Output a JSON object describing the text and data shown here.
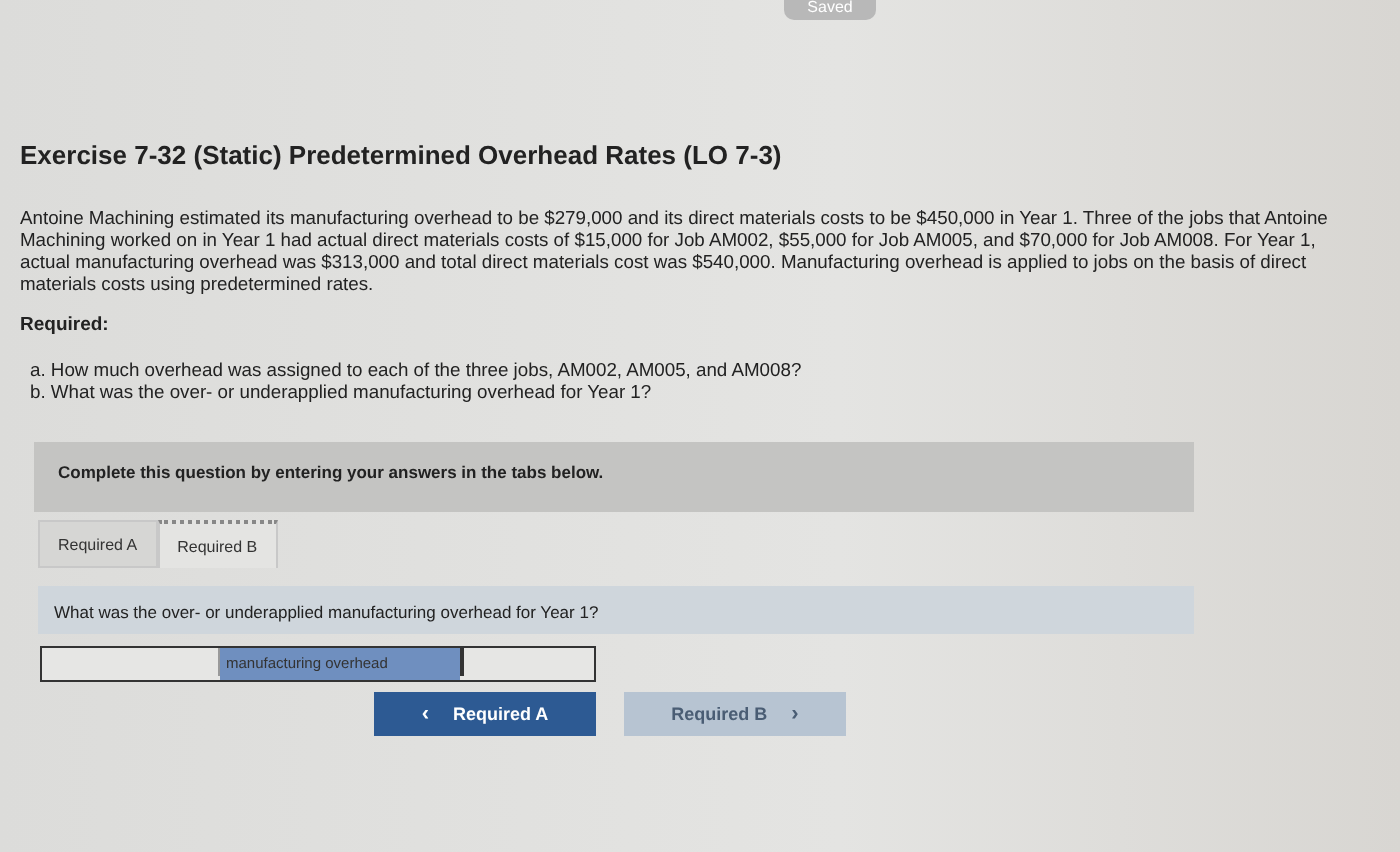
{
  "status": "Saved",
  "title": "Exercise 7-32 (Static) Predetermined Overhead Rates (LO 7-3)",
  "paragraph": "Antoine Machining estimated its manufacturing overhead to be $279,000 and its direct materials costs to be $450,000 in Year 1. Three of the jobs that Antoine Machining worked on in Year 1 had actual direct materials costs of $15,000 for Job AM002, $55,000 for Job AM005, and $70,000 for Job AM008. For Year 1, actual manufacturing overhead was $313,000 and total direct materials cost was $540,000. Manufacturing overhead is applied to jobs on the basis of direct materials costs using predetermined rates.",
  "required_heading": "Required:",
  "questions": [
    "a. How much overhead was assigned to each of the three jobs, AM002, AM005, and AM008?",
    "b. What was the over- or underapplied manufacturing overhead for Year 1?"
  ],
  "instruction": "Complete this question by entering your answers in the tabs below.",
  "tabs": [
    {
      "label": "Required A",
      "selected": false
    },
    {
      "label": "Required B",
      "selected": true
    }
  ],
  "prompt": "What was the over- or underapplied manufacturing overhead for Year 1?",
  "answer_row": {
    "selection": "manufacturing overhead"
  },
  "nav_buttons": [
    {
      "label": "Required A",
      "icon": "‹",
      "kind": "prev",
      "disabled": false
    },
    {
      "label": "Required B",
      "icon": "›",
      "kind": "next",
      "disabled": true
    }
  ]
}
